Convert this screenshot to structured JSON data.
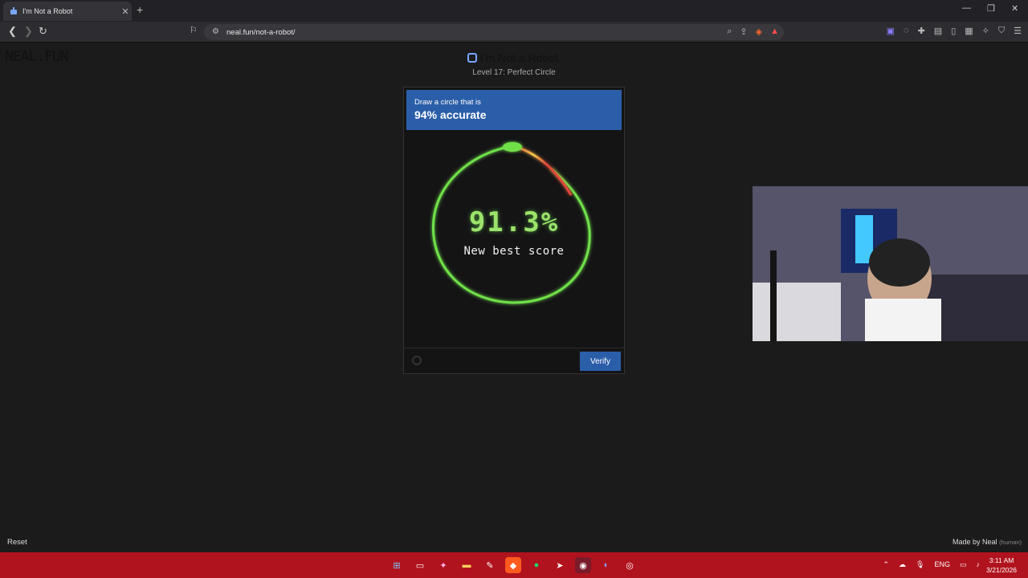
{
  "browser": {
    "tab_title": "I'm Not a Robot",
    "tab_close": "✕",
    "new_tab": "+",
    "url": "neal.fun/not-a-robot/",
    "window_controls": [
      "—",
      "❐",
      "✕"
    ]
  },
  "page": {
    "logo": "NEAL.FUN",
    "title": "I'm Not a Robot",
    "level": "Level 17: Perfect Circle"
  },
  "captcha": {
    "instruction": "Draw a circle that is",
    "target": "94% accurate",
    "score": "91.3%",
    "score_note": "New best score",
    "verify_label": "Verify"
  },
  "footer": {
    "reset_label": "Reset",
    "made_by": "Made by Neal",
    "made_by_note": "(human)"
  },
  "taskbar": {
    "time": "3:11 AM",
    "date": "3/21/2026",
    "language": "ENG"
  },
  "colors": {
    "accent_blue": "#2b5ea8",
    "taskbar_red": "#b0131d",
    "stroke_green": "#6fe04a",
    "stroke_red": "#e04a3a"
  }
}
